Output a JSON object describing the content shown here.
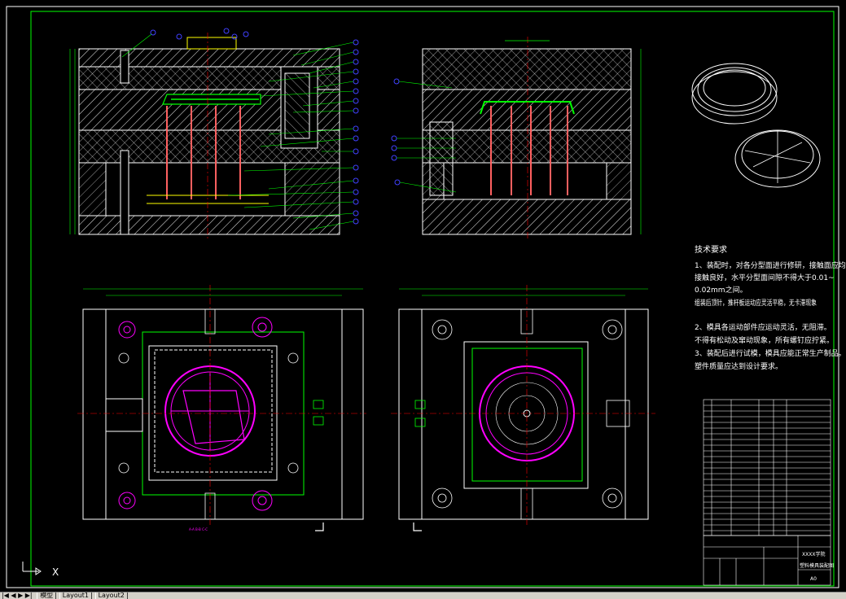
{
  "drawing": {
    "tech_requirements": {
      "title": "技术要求",
      "lines": [
        "1、装配时，对各分型面进行修研，接触面应均匀",
        "接触良好，水平分型面间隙不得大于0.01~",
        "0.02mm之间。",
        "组装后顶针，推杆板运动应灵活平稳，无卡滞现象",
        "2、模具各运动部件应运动灵活，无阻滞。",
        "不得有松动及窜动现象，所有螺钉应拧紧。",
        "3、装配后进行试模，模具应能正常生产制品。",
        "塑件质量应达到设计要求。"
      ]
    },
    "title_block": {
      "company": "XXXX学院",
      "drawing_name": "塑料模具装配图",
      "scale": "A0"
    },
    "part_line_label": "A-A   B-B   C-C"
  },
  "colors": {
    "frame": "#00ff00",
    "outline": "#ffffff",
    "hatch": "#ffffff",
    "part": "#ff00ff",
    "bolt": "#ff6060",
    "dim": "#00ff00",
    "center": "#ff0000",
    "balloon": "#4040ff",
    "yellow": "#ffff00"
  },
  "status_bar": {
    "ucs_label": "X",
    "tabs": [
      "模型",
      "Layout1",
      "Layout2"
    ],
    "nav_arrows": "|◀ ◀ ▶ ▶|"
  }
}
